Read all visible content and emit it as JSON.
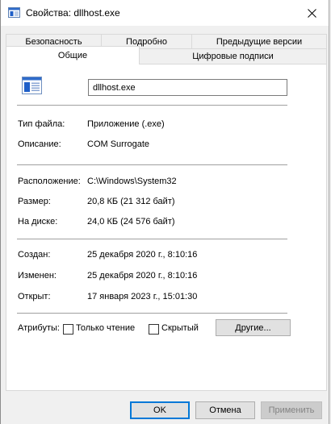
{
  "window": {
    "title": "Свойства: dllhost.exe",
    "close_icon": "close-icon"
  },
  "tabs": {
    "back_row": [
      {
        "label": "Безопасность"
      },
      {
        "label": "Подробно"
      },
      {
        "label": "Предыдущие версии"
      }
    ],
    "front_row": [
      {
        "label": "Общие",
        "selected": true
      },
      {
        "label": "Цифровые подписи",
        "selected": false
      }
    ]
  },
  "general": {
    "file_icon": "application-window-icon",
    "file_name": "dllhost.exe",
    "type_label": "Тип файла:",
    "type_value": "Приложение (.exe)",
    "description_label": "Описание:",
    "description_value": "COM Surrogate",
    "location_label": "Расположение:",
    "location_value": "C:\\Windows\\System32",
    "size_label": "Размер:",
    "size_value": "20,8 КБ (21 312 байт)",
    "disk_label": "На диске:",
    "disk_value": "24,0 КБ (24 576 байт)",
    "created_label": "Создан:",
    "created_value": "25 декабря 2020 г., 8:10:16",
    "modified_label": "Изменен:",
    "modified_value": "25 декабря 2020 г., 8:10:16",
    "opened_label": "Открыт:",
    "opened_value": "17 января 2023 г., 15:01:30",
    "attributes_label": "Атрибуты:",
    "readonly_label": "Только чтение",
    "readonly_checked": false,
    "hidden_label": "Скрытый",
    "hidden_checked": false,
    "other_button": "Другие..."
  },
  "footer": {
    "ok": "OK",
    "cancel": "Отмена",
    "apply": "Применить"
  },
  "colors": {
    "accent": "#0078d7",
    "window_bg": "#f0f0f0",
    "panel_bg": "#ffffff"
  }
}
